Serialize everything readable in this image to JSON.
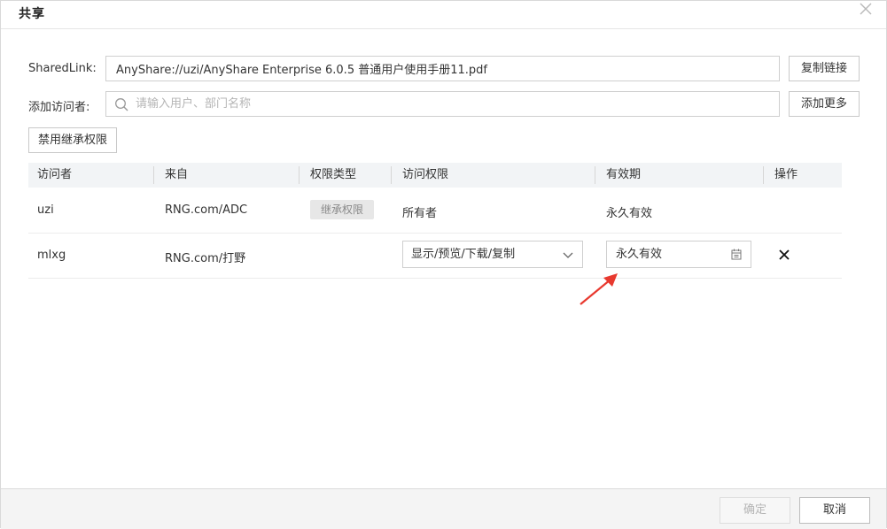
{
  "dialog": {
    "title": "共享",
    "close_icon": "close-icon"
  },
  "shared_link": {
    "label": "SharedLink:",
    "value": "AnyShare://uzi/AnyShare Enterprise 6.0.5 普通用户使用手册11.pdf",
    "copy_button": "复制链接"
  },
  "add_visitor": {
    "label": "添加访问者:",
    "placeholder": "请输入用户、部门名称",
    "more_button": "添加更多"
  },
  "disable_inherit_button": "禁用继承权限",
  "table": {
    "headers": [
      "访问者",
      "来自",
      "权限类型",
      "访问权限",
      "有效期",
      "操作"
    ],
    "rows": [
      {
        "visitor": "uzi",
        "from": "RNG.com/ADC",
        "type_badge": "继承权限",
        "permission": "所有者",
        "validity": "永久有效"
      },
      {
        "visitor": "mlxg",
        "from": "RNG.com/打野",
        "permission_select": "显示/预览/下载/复制",
        "validity_input": "永久有效",
        "action_icon": "delete-icon"
      }
    ]
  },
  "footer": {
    "ok_button": "确定",
    "cancel_button": "取消"
  },
  "colors": {
    "annotation_arrow": "#e8392f",
    "header_bg": "#f2f4f6",
    "footer_bg": "#f4f4f4"
  }
}
